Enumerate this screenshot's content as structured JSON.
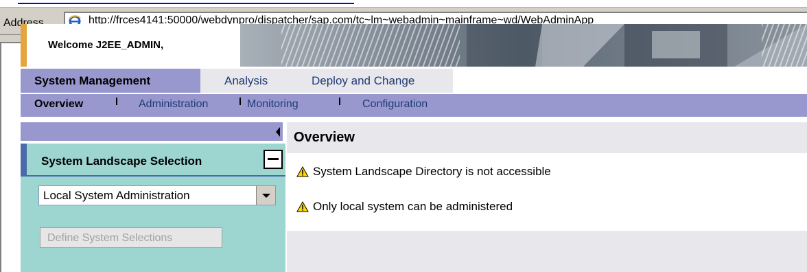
{
  "browser": {
    "address_label": "Address",
    "address_url": "http://frces4141:50000/webdynpro/dispatcher/sap.com/tc~lm~webadmin~mainframe~wd/WebAdminApp"
  },
  "header": {
    "welcome": "Welcome J2EE_ADMIN,"
  },
  "top_nav": {
    "items": [
      "System Management",
      "Analysis",
      "Deploy and Change"
    ]
  },
  "sub_nav": {
    "items": [
      "Overview",
      "Administration",
      "Monitoring",
      "Configuration"
    ]
  },
  "left_panel": {
    "title": "System Landscape Selection",
    "selected_system": "Local System Administration",
    "define_button": "Define System Selections"
  },
  "content": {
    "title": "Overview",
    "messages": [
      "System Landscape Directory is not accessible",
      "Only local system can be administered"
    ]
  },
  "colors": {
    "nav_purple": "#9898cf",
    "panel_teal": "#9dd5d0",
    "header_accent": "#e3a53c",
    "panel_accent": "#4a6aa8",
    "link_blue": "#1f3a75"
  },
  "icons": [
    "ie-icon",
    "warning-icon",
    "collapse-arrow-icon",
    "minimize-icon",
    "dropdown-arrow-icon"
  ]
}
